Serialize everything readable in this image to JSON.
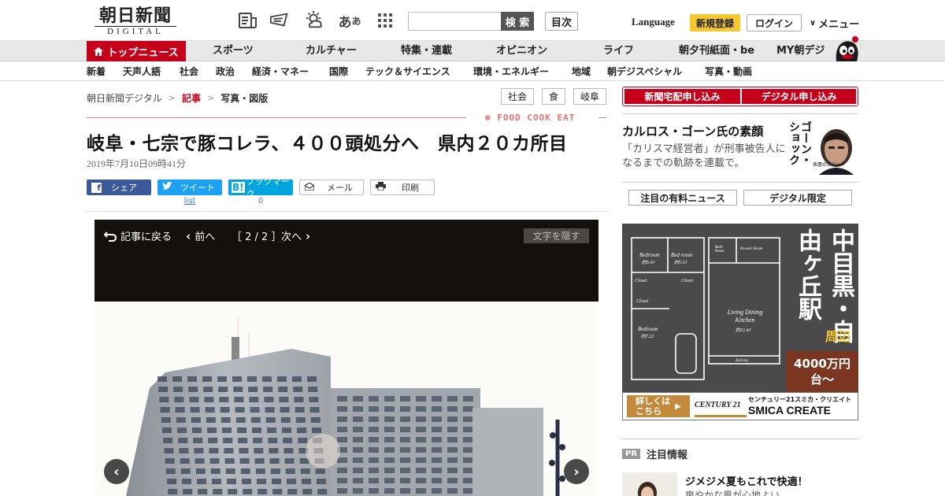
{
  "header": {
    "logo_kanji": "朝日新聞",
    "logo_sub": "DIGITAL",
    "search_button": "検 索",
    "toc_button": "目次",
    "language": "Language",
    "register": "新規登録",
    "login": "ログイン",
    "menu": "メニュー"
  },
  "mainnav": {
    "top_news": "トップニュース",
    "items": [
      "スポーツ",
      "カルチャー",
      "特集・連載",
      "オピニオン",
      "ライフ",
      "朝夕刊紙面・be",
      "MY朝デジ"
    ]
  },
  "subnav": {
    "items": [
      "新着",
      "天声人語",
      "社会",
      "政治",
      "経済・マネー",
      "国際",
      "テック＆サイエンス",
      "環境・エネルギー",
      "地域",
      "朝デジスペシャル",
      "写真・動画"
    ]
  },
  "breadcrumb": [
    "朝日新聞デジタル",
    "記事",
    "写真・図版"
  ],
  "breadcrumb_sep": ">",
  "tags": [
    "社会",
    "食",
    "岐阜"
  ],
  "section_label": "FOOD COOK EAT",
  "article": {
    "title": "岐阜・七宗で豚コレラ、４００頭処分へ　県内２０カ所目",
    "date": "2019年7月10日09時41分"
  },
  "share": {
    "facebook": "シェア",
    "twitter": "ツイート",
    "twitter_count": "list",
    "hatena": "ブックマーク",
    "hatena_prefix": "B!",
    "hatena_count": "0",
    "mail": "メール",
    "print": "印刷"
  },
  "viewer": {
    "back": "記事に戻る",
    "prev": "前へ",
    "counter": "［ 2 / 2 ］",
    "next": "次へ",
    "hide_text": "文字を隠す"
  },
  "sidebar": {
    "subscribe_paper": "新聞宅配申し込み",
    "subscribe_digital": "デジタル申し込み",
    "feature_title": "カルロス・ゴーン氏の素顔",
    "feature_desc": "「カリスマ経営者」が刑事被告人になるまでの軌跡を連載で。",
    "feature_img_text": "ゴーン・ショック",
    "feature_img_caption": "表層のビジャヤ",
    "tab_paid": "注目の有料ニュース",
    "tab_digital": "デジタル限定",
    "pr_badge": "PR",
    "pr_heading": "注目情報",
    "pr_title": "ジメジメ夏もこれで快適！",
    "pr_sub": "爽やかな風が心地よい"
  },
  "ad": {
    "big_text": "中目黒・自由ヶ丘駅",
    "area": "周辺",
    "price": "4000万円台～",
    "cta": "詳しくはこちら",
    "brand": "CENTURY 21",
    "brand_sub": "センチュリー21スミカ・クリエイト",
    "brand_main": "SMICA CREATE",
    "floorplan_labels": [
      "Bedroom",
      "Bed room",
      "Closet",
      "Closet",
      "Closet",
      "Bedroom",
      "Bath Room",
      "Powder Room",
      "Living Dining Kitchen",
      "Balcony"
    ],
    "floorplan_sizes": [
      "約5.4J",
      "約5.5J",
      "約7.2J",
      "約22.4J"
    ]
  },
  "colors": {
    "brand_red": "#c5001a",
    "register_yellow": "#f5c832",
    "facebook": "#3b5998",
    "twitter": "#1da1f2",
    "hatena": "#00a4de"
  }
}
